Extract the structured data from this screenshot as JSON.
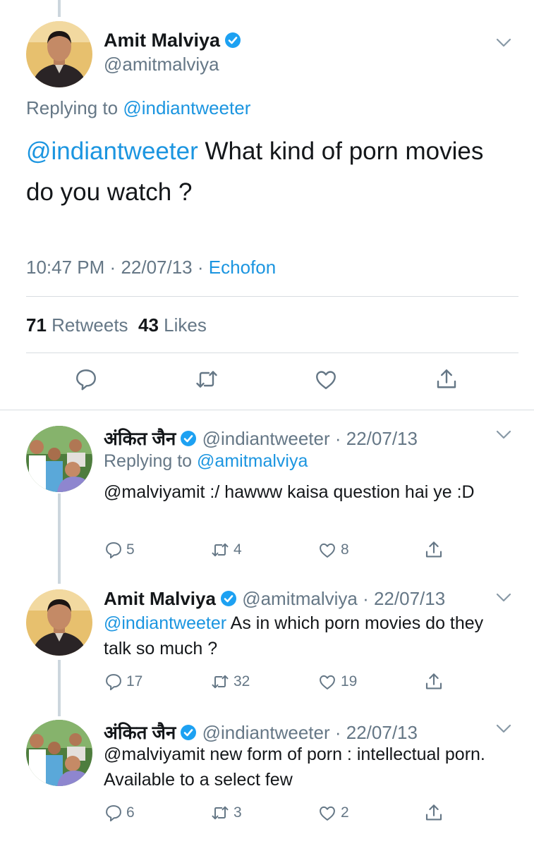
{
  "colors": {
    "link": "#1b95e0",
    "secondary": "#657786",
    "verified": "#1da1f2",
    "divider": "#d8dde1"
  },
  "main_tweet": {
    "name": "Amit Malviya",
    "handle": "@amitmalviya",
    "replying_prefix": "Replying to",
    "replying_to": "@indiantweeter",
    "mention": "@indiantweeter",
    "text": " What kind of porn movies do you watch ?",
    "time": "10:47 PM",
    "date": "22/07/13",
    "source": "Echofon",
    "sep": "·",
    "retweet_count": "71",
    "retweet_label": "Retweets",
    "like_count": "43",
    "like_label": "Likes",
    "actions": [
      "reply-icon",
      "retweet-icon",
      "like-icon",
      "share-icon"
    ]
  },
  "replies": [
    {
      "name": "अंकित जैन",
      "handle": "@indiantweeter",
      "date": "· 22/07/13",
      "replying_prefix": "Replying to",
      "replying_to": "@amitmalviya",
      "mention": "",
      "text": "@malviyamit :/ hawww kaisa question hai ye :D",
      "reply_count": "5",
      "retweet_count": "4",
      "like_count": "8"
    },
    {
      "name": "Amit Malviya",
      "handle": "@amitmalviya",
      "date": "· 22/07/13",
      "mention": "@indiantweeter",
      "text": " As in which porn movies do they talk so much ?",
      "reply_count": "17",
      "retweet_count": "32",
      "like_count": "19"
    },
    {
      "name": "अंकित जैन",
      "handle": "@indiantweeter",
      "date": "· 22/07/13",
      "mention": "",
      "text": "@malviyamit new form of porn : intellectual porn. Available to a select few",
      "reply_count": "6",
      "retweet_count": "3",
      "like_count": "2"
    }
  ]
}
